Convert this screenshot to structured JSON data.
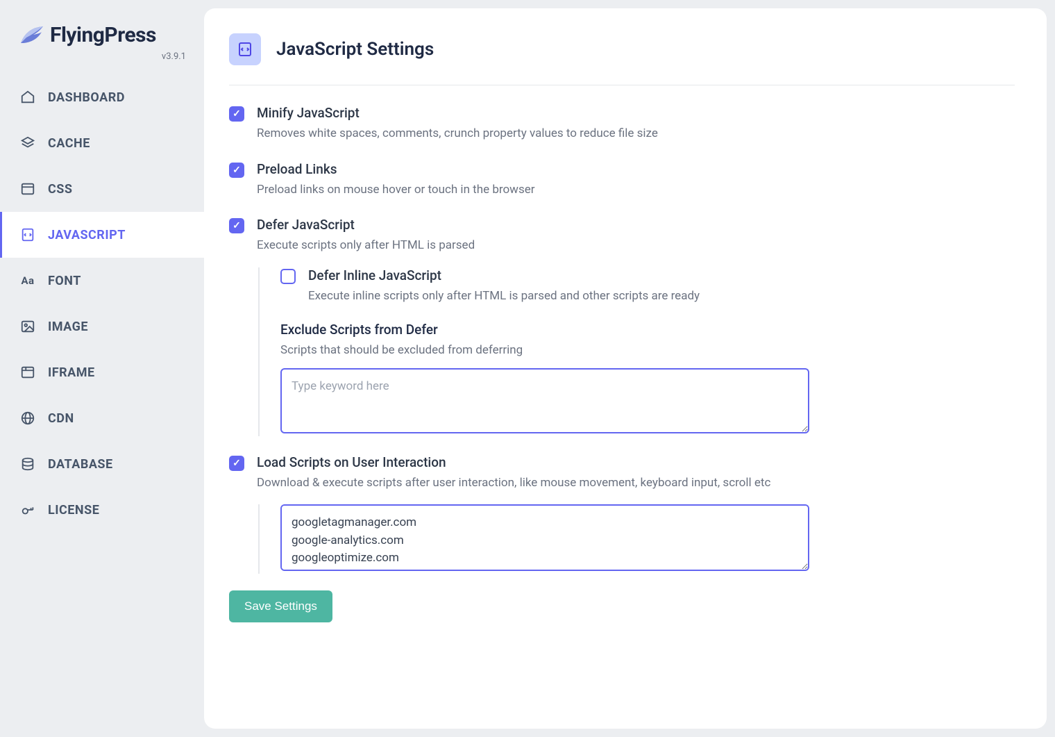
{
  "brand": {
    "name": "FlyingPress",
    "version": "v3.9.1"
  },
  "sidebar": {
    "items": [
      {
        "label": "DASHBOARD",
        "icon": "home-icon"
      },
      {
        "label": "CACHE",
        "icon": "layers-icon"
      },
      {
        "label": "CSS",
        "icon": "css-icon"
      },
      {
        "label": "JAVASCRIPT",
        "icon": "javascript-icon",
        "active": true
      },
      {
        "label": "FONT",
        "icon": "font-icon"
      },
      {
        "label": "IMAGE",
        "icon": "image-icon"
      },
      {
        "label": "IFRAME",
        "icon": "iframe-icon"
      },
      {
        "label": "CDN",
        "icon": "globe-icon"
      },
      {
        "label": "DATABASE",
        "icon": "database-icon"
      },
      {
        "label": "LICENSE",
        "icon": "key-icon"
      }
    ]
  },
  "page": {
    "title": "JavaScript Settings"
  },
  "settings": {
    "minify": {
      "checked": true,
      "title": "Minify JavaScript",
      "desc": "Removes white spaces, comments, crunch property values to reduce file size"
    },
    "preload": {
      "checked": true,
      "title": "Preload Links",
      "desc": "Preload links on mouse hover or touch in the browser"
    },
    "defer": {
      "checked": true,
      "title": "Defer JavaScript",
      "desc": "Execute scripts only after HTML is parsed",
      "inline": {
        "checked": false,
        "title": "Defer Inline JavaScript",
        "desc": "Execute inline scripts only after HTML is parsed and other scripts are ready"
      },
      "exclude": {
        "title": "Exclude Scripts from Defer",
        "desc": "Scripts that should be excluded from deferring",
        "placeholder": "Type keyword here",
        "value": ""
      }
    },
    "interaction": {
      "checked": true,
      "title": "Load Scripts on User Interaction",
      "desc": "Download & execute scripts after user interaction, like mouse movement, keyboard input, scroll etc",
      "textarea_value": "googletagmanager.com\ngoogle-analytics.com\ngoogleoptimize.com"
    }
  },
  "save_button": "Save Settings",
  "colors": {
    "accent": "#6366f1",
    "save": "#4eb6a2"
  }
}
